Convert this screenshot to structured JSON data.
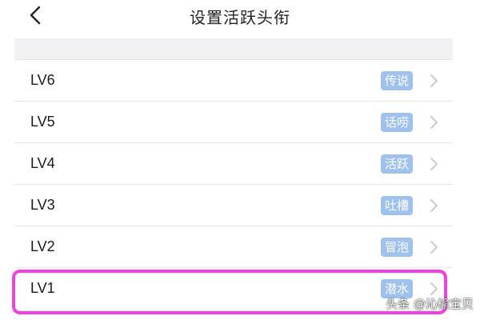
{
  "header": {
    "title": "设置活跃头衔"
  },
  "levels": [
    {
      "label": "LV6",
      "badge": "传说"
    },
    {
      "label": "LV5",
      "badge": "话唠"
    },
    {
      "label": "LV4",
      "badge": "活跃"
    },
    {
      "label": "LV3",
      "badge": "吐槽"
    },
    {
      "label": "LV2",
      "badge": "冒泡"
    },
    {
      "label": "LV1",
      "badge": "潜水"
    }
  ],
  "watermark": "头条 @沁榆宝贝",
  "colors": {
    "badge_bg": "#9fc1ee",
    "highlight": "#f23fe2",
    "section_bg": "#f2f2f4"
  },
  "icons": {
    "back": "chevron-left-icon",
    "row_arrow": "chevron-right-icon"
  }
}
